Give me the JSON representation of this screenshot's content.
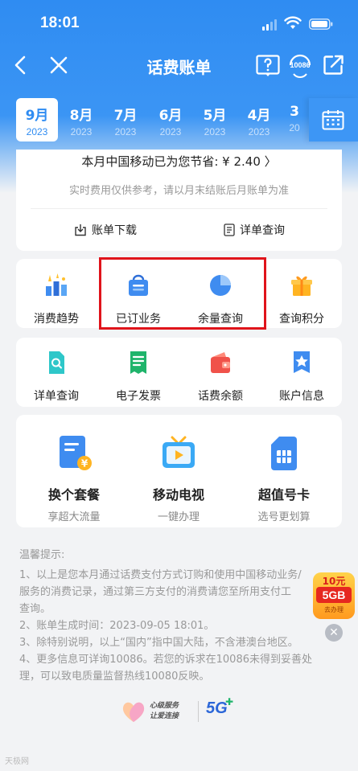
{
  "status_bar": {
    "time": "18:01"
  },
  "nav": {
    "title": "话费账单",
    "service_badge": "10086"
  },
  "months": [
    {
      "month": "9月",
      "year": "2023",
      "active": true
    },
    {
      "month": "8月",
      "year": "2023"
    },
    {
      "month": "7月",
      "year": "2023"
    },
    {
      "month": "6月",
      "year": "2023"
    },
    {
      "month": "5月",
      "year": "2023"
    },
    {
      "month": "4月",
      "year": "2023"
    },
    {
      "month": "3",
      "year": "20"
    }
  ],
  "bill": {
    "saved_text": "本月中国移动已为您节省: ¥ 2.40 〉",
    "note": "实时费用仅供参考，请以月末结账后月账单为准",
    "download_label": "账单下载",
    "detail_label": "详单查询"
  },
  "grid1": [
    {
      "label": "消费趋势",
      "icon": "trend-icon"
    },
    {
      "label": "已订业务",
      "icon": "basket-icon"
    },
    {
      "label": "余量查询",
      "icon": "pie-icon"
    },
    {
      "label": "查询积分",
      "icon": "gift-icon"
    }
  ],
  "grid2": [
    {
      "label": "详单查询",
      "icon": "doc-search-icon"
    },
    {
      "label": "电子发票",
      "icon": "invoice-icon"
    },
    {
      "label": "话费余额",
      "icon": "wallet-icon"
    },
    {
      "label": "账户信息",
      "icon": "star-badge-icon"
    }
  ],
  "featured": [
    {
      "title": "换个套餐",
      "subtitle": "享超大流量",
      "icon": "plan-icon"
    },
    {
      "title": "移动电视",
      "subtitle": "一键办理",
      "icon": "tv-icon"
    },
    {
      "title": "超值号卡",
      "subtitle": "选号更划算",
      "icon": "sim-icon"
    }
  ],
  "tips": {
    "heading": "温馨提示:",
    "lines": [
      "1、以上是您本月通过话费支付方式订购和使用中国移动业务/",
      "服务的消费记录，通过第三方支付的消费请您至所用支付工",
      "查询。",
      "2、账单生成时间：2023-09-05 18:01。",
      "3、除特别说明，以上“国内”指中国大陆，不含港澳台地区。",
      "4、更多信息可详询10086。若您的诉求在10086未得到妥善处",
      "理，可以致电质量监督热线10080反映。"
    ]
  },
  "promo": {
    "line1": "10元",
    "line2": "5GB",
    "line3": "去办理"
  },
  "footer": {
    "slogan_1": "心级服务",
    "slogan_2": "让爱连接",
    "badge": "5G"
  },
  "watermark": "天极网"
}
